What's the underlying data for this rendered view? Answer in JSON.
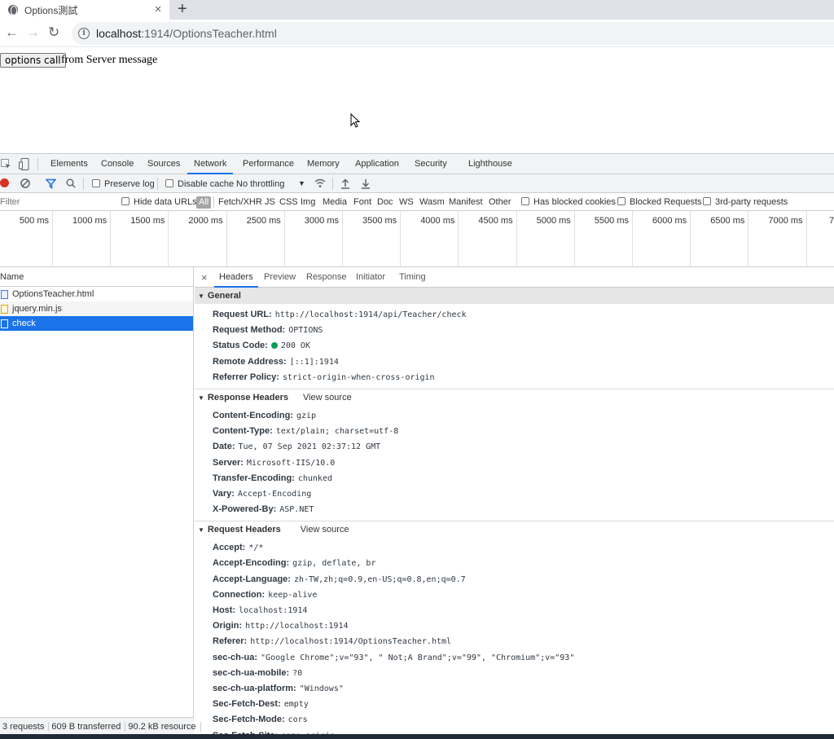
{
  "browser": {
    "tab_title": "Options測試",
    "new_tab": "+",
    "url_host": "localhost",
    "url_path": ":1914/OptionsTeacher.html",
    "colors": {
      "tab_strip": "#dee1e6",
      "omnibox": "#f1f3f4"
    }
  },
  "page": {
    "button_label": "options call",
    "message": "from Server message"
  },
  "devtools": {
    "tabs": [
      "Elements",
      "Console",
      "Sources",
      "Network",
      "Performance",
      "Memory",
      "Application",
      "Security",
      "Lighthouse"
    ],
    "active_tab": "Network",
    "toolbar": {
      "preserve_log": "Preserve log",
      "disable_cache": "Disable cache",
      "throttling": "No throttling"
    },
    "filter": {
      "placeholder": "Filter",
      "hide_data_urls": "Hide data URLs",
      "types": [
        "All",
        "Fetch/XHR",
        "JS",
        "CSS",
        "Img",
        "Media",
        "Font",
        "Doc",
        "WS",
        "Wasm",
        "Manifest",
        "Other"
      ],
      "has_blocked_cookies": "Has blocked cookies",
      "blocked_requests": "Blocked Requests",
      "third_party": "3rd-party requests"
    },
    "timeline_labels": [
      "500 ms",
      "1000 ms",
      "1500 ms",
      "2000 ms",
      "2500 ms",
      "3000 ms",
      "3500 ms",
      "4000 ms",
      "4500 ms",
      "5000 ms",
      "5500 ms",
      "6000 ms",
      "6500 ms",
      "7000 ms",
      "7"
    ],
    "requests": {
      "header": "Name",
      "items": [
        "OptionsTeacher.html",
        "jquery.min.js",
        "check"
      ],
      "selected": "check",
      "status": [
        "3 requests",
        "609 B transferred",
        "90.2 kB resource"
      ]
    },
    "details": {
      "close": "×",
      "tabs": [
        "Headers",
        "Preview",
        "Response",
        "Initiator",
        "Timing"
      ],
      "general_title": "General",
      "general": [
        {
          "k": "Request URL:",
          "v": "http://localhost:1914/api/Teacher/check"
        },
        {
          "k": "Request Method:",
          "v": "OPTIONS"
        },
        {
          "k": "Status Code:",
          "v": "200 OK"
        },
        {
          "k": "Remote Address:",
          "v": "[::1]:1914"
        },
        {
          "k": "Referrer Policy:",
          "v": "strict-origin-when-cross-origin"
        }
      ],
      "response_title": "Response Headers",
      "view_source": "View source",
      "response": [
        {
          "k": "Content-Encoding:",
          "v": "gzip"
        },
        {
          "k": "Content-Type:",
          "v": "text/plain; charset=utf-8"
        },
        {
          "k": "Date:",
          "v": "Tue, 07 Sep 2021 02:37:12 GMT"
        },
        {
          "k": "Server:",
          "v": "Microsoft-IIS/10.0"
        },
        {
          "k": "Transfer-Encoding:",
          "v": "chunked"
        },
        {
          "k": "Vary:",
          "v": "Accept-Encoding"
        },
        {
          "k": "X-Powered-By:",
          "v": "ASP.NET"
        }
      ],
      "request_title": "Request Headers",
      "request": [
        {
          "k": "Accept:",
          "v": "*/*"
        },
        {
          "k": "Accept-Encoding:",
          "v": "gzip, deflate, br"
        },
        {
          "k": "Accept-Language:",
          "v": "zh-TW,zh;q=0.9,en-US;q=0.8,en;q=0.7"
        },
        {
          "k": "Connection:",
          "v": "keep-alive"
        },
        {
          "k": "Host:",
          "v": "localhost:1914"
        },
        {
          "k": "Origin:",
          "v": "http://localhost:1914"
        },
        {
          "k": "Referer:",
          "v": "http://localhost:1914/OptionsTeacher.html"
        },
        {
          "k": "sec-ch-ua:",
          "v": "\"Google Chrome\";v=\"93\", \" Not;A Brand\";v=\"99\", \"Chromium\";v=\"93\""
        },
        {
          "k": "sec-ch-ua-mobile:",
          "v": "?0"
        },
        {
          "k": "sec-ch-ua-platform:",
          "v": "\"Windows\""
        },
        {
          "k": "Sec-Fetch-Dest:",
          "v": "empty"
        },
        {
          "k": "Sec-Fetch-Mode:",
          "v": "cors"
        },
        {
          "k": "Sec-Fetch-Site:",
          "v": "same-origin"
        }
      ]
    },
    "colors": {
      "accent": "#1a73e8",
      "record": "#d93025",
      "status_ok": "#0d9d58"
    }
  }
}
